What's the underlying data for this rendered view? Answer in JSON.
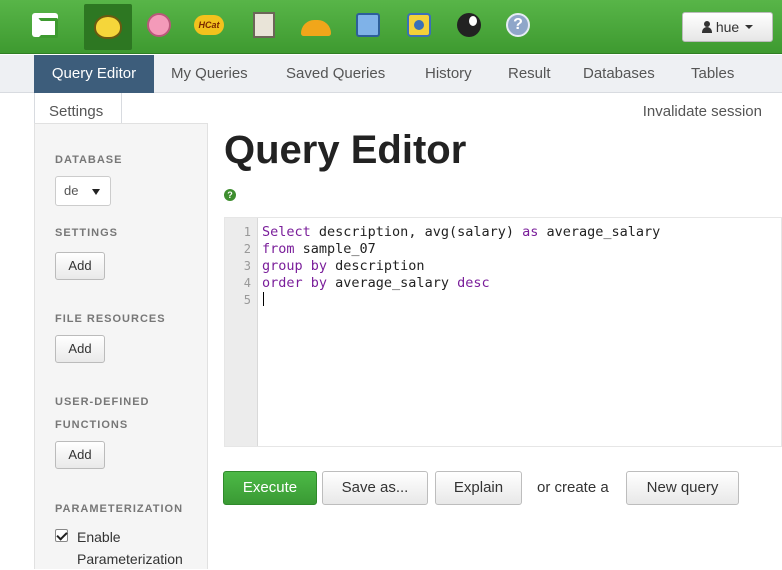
{
  "topbar": {
    "apps": [
      {
        "icon": "hue-logo-icon"
      },
      {
        "icon": "beeswax-icon"
      },
      {
        "icon": "pig-icon"
      },
      {
        "icon": "hcatalog-icon",
        "label": "HCat"
      },
      {
        "icon": "file-browser-icon"
      },
      {
        "icon": "job-designer-icon"
      },
      {
        "icon": "job-browser-icon"
      },
      {
        "icon": "oozie-icon"
      },
      {
        "icon": "globe-icon"
      },
      {
        "icon": "help-icon",
        "label": "?"
      }
    ],
    "user_label": "hue"
  },
  "tabs": [
    "Query Editor",
    "My Queries",
    "Saved Queries",
    "History",
    "Result",
    "Databases",
    "Tables"
  ],
  "settings_tab": "Settings",
  "invalidate_session": "Invalidate session",
  "sidebar": {
    "database_header": "DATABASE",
    "database_value": "de",
    "settings_header": "SETTINGS",
    "file_resources_header": "FILE RESOURCES",
    "udf_header_line1": "USER-DEFINED",
    "udf_header_line2": "FUNCTIONS",
    "parameterization_header": "PARAMETERIZATION",
    "add_label": "Add",
    "enable_param_line1": "Enable",
    "enable_param_line2": "Parameterization"
  },
  "main": {
    "title": "Query Editor",
    "help_glyph": "?",
    "code": {
      "line_numbers": [
        "1",
        "2",
        "3",
        "4",
        "5"
      ],
      "l1_kw1": "Select",
      "l1_text": " description, avg(salary) ",
      "l1_kw2": "as",
      "l1_text2": " average_salary",
      "l2_kw": "from",
      "l2_text": " sample_07",
      "l3_kw": "group by",
      "l3_text": " description",
      "l4_kw": "order by",
      "l4_text": " average_salary ",
      "l4_kw2": "desc"
    },
    "execute_label": "Execute",
    "save_as_label": "Save as...",
    "explain_label": "Explain",
    "or_create_text": "or create a",
    "new_query_label": "New query"
  },
  "colors": {
    "topbar_green": "#3e9a30",
    "active_tab": "#3d5d7b",
    "execute_green": "#3a9a34",
    "keyword_purple": "#7a1e9a"
  }
}
